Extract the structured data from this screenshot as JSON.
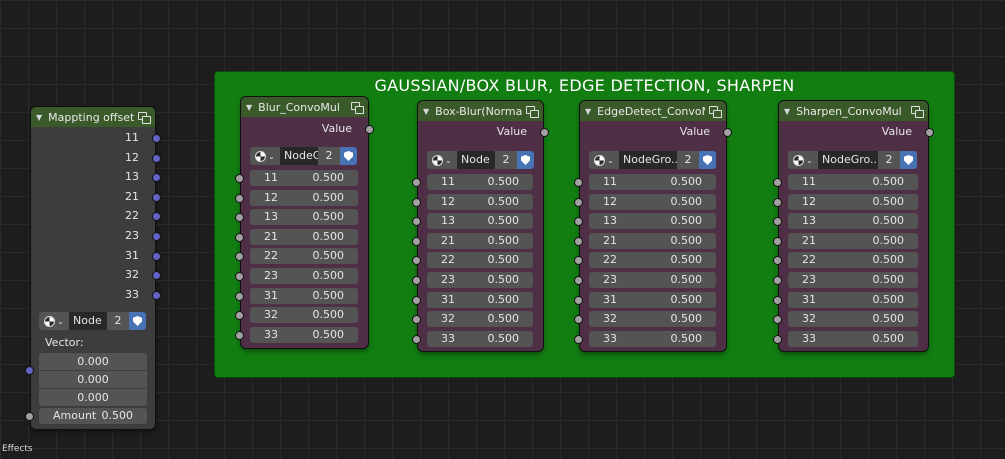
{
  "frame": {
    "title": "GAUSSIAN/BOX BLUR, EDGE DETECTION, SHARPEN",
    "color": "#127e12"
  },
  "mapping": {
    "title": "Mappting offset",
    "outputs": [
      "11",
      "12",
      "13",
      "21",
      "22",
      "23",
      "31",
      "32",
      "33"
    ],
    "datablock": {
      "name": "Node",
      "users": "2"
    },
    "vector_label": "Vector:",
    "vector": [
      "0.000",
      "0.000",
      "0.000"
    ],
    "amount_label": "Amount",
    "amount_value": "0.500"
  },
  "nodes": [
    {
      "title": "Blur_ConvoMul",
      "output": "Value",
      "datablock": "NodeG",
      "users": "2",
      "inputs": [
        {
          "label": "11",
          "value": "0.500"
        },
        {
          "label": "12",
          "value": "0.500"
        },
        {
          "label": "13",
          "value": "0.500"
        },
        {
          "label": "21",
          "value": "0.500"
        },
        {
          "label": "22",
          "value": "0.500"
        },
        {
          "label": "23",
          "value": "0.500"
        },
        {
          "label": "31",
          "value": "0.500"
        },
        {
          "label": "32",
          "value": "0.500"
        },
        {
          "label": "33",
          "value": "0.500"
        }
      ]
    },
    {
      "title": "Box-Blur(Normali..",
      "output": "Value",
      "datablock": "Node",
      "users": "2",
      "inputs": [
        {
          "label": "11",
          "value": "0.500"
        },
        {
          "label": "12",
          "value": "0.500"
        },
        {
          "label": "13",
          "value": "0.500"
        },
        {
          "label": "21",
          "value": "0.500"
        },
        {
          "label": "22",
          "value": "0.500"
        },
        {
          "label": "23",
          "value": "0.500"
        },
        {
          "label": "31",
          "value": "0.500"
        },
        {
          "label": "32",
          "value": "0.500"
        },
        {
          "label": "33",
          "value": "0.500"
        }
      ]
    },
    {
      "title": "EdgeDetect_ConvoMul",
      "output": "Value",
      "datablock": "NodeGro..",
      "users": "2",
      "inputs": [
        {
          "label": "11",
          "value": "0.500"
        },
        {
          "label": "12",
          "value": "0.500"
        },
        {
          "label": "13",
          "value": "0.500"
        },
        {
          "label": "21",
          "value": "0.500"
        },
        {
          "label": "22",
          "value": "0.500"
        },
        {
          "label": "23",
          "value": "0.500"
        },
        {
          "label": "31",
          "value": "0.500"
        },
        {
          "label": "32",
          "value": "0.500"
        },
        {
          "label": "33",
          "value": "0.500"
        }
      ]
    },
    {
      "title": "Sharpen_ConvoMul",
      "output": "Value",
      "datablock": "NodeGro..",
      "users": "2",
      "inputs": [
        {
          "label": "11",
          "value": "0.500"
        },
        {
          "label": "12",
          "value": "0.500"
        },
        {
          "label": "13",
          "value": "0.500"
        },
        {
          "label": "21",
          "value": "0.500"
        },
        {
          "label": "22",
          "value": "0.500"
        },
        {
          "label": "23",
          "value": "0.500"
        },
        {
          "label": "31",
          "value": "0.500"
        },
        {
          "label": "32",
          "value": "0.500"
        },
        {
          "label": "33",
          "value": "0.500"
        }
      ]
    }
  ],
  "footer": {
    "label": "Effects"
  },
  "colors": {
    "node_body": "#4f2f46",
    "header": "#3a5a2a",
    "socket_value": "#a1a1a1",
    "socket_vector": "#6363c7",
    "accent": "#4772b3"
  }
}
